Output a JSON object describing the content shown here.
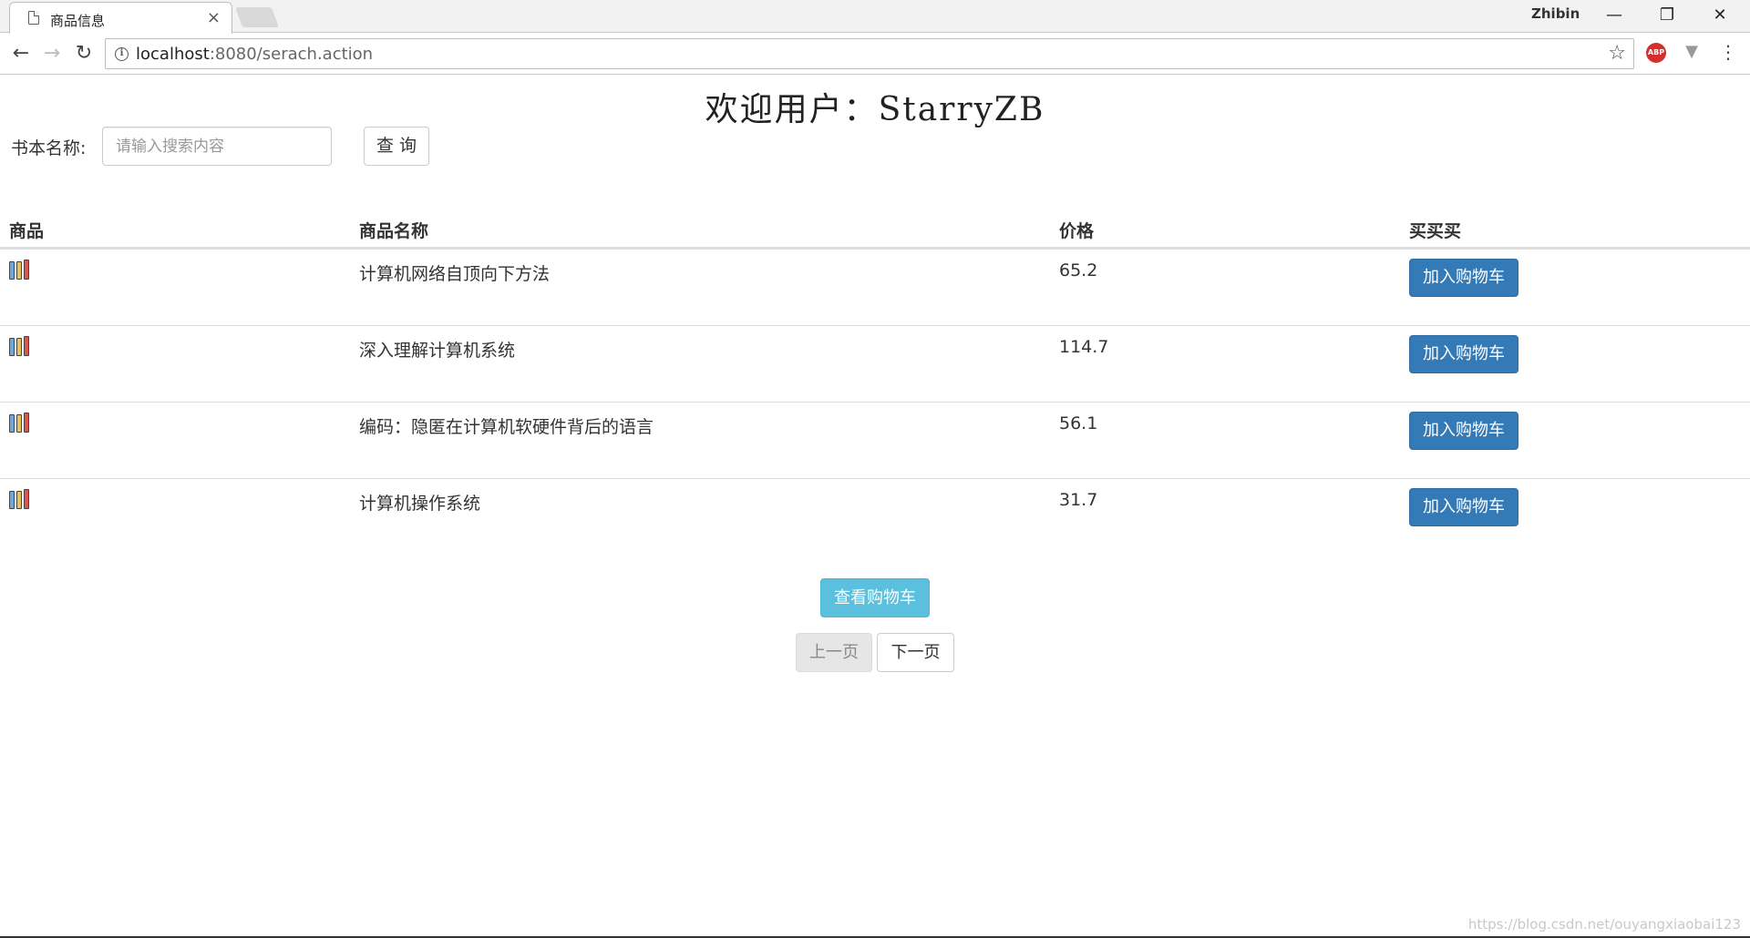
{
  "browser": {
    "tab_title": "商品信息",
    "tab_close": "×",
    "profile_name": "Zhibin",
    "url_host": "localhost",
    "url_rest": ":8080/serach.action",
    "window_buttons": {
      "minimize": "—",
      "restore": "❐",
      "close": "✕"
    },
    "ext_abp_label": "ABP"
  },
  "page": {
    "welcome": "欢迎用户：StarryZB",
    "search": {
      "label": "书本名称:",
      "placeholder": "请输入搜索内容",
      "button": "查 询"
    },
    "table": {
      "headers": [
        "商品",
        "商品名称",
        "价格",
        "买买买"
      ],
      "rows": [
        {
          "name": "计算机网络自顶向下方法",
          "price": "65.2",
          "action": "加入购物车"
        },
        {
          "name": "深入理解计算机系统",
          "price": "114.7",
          "action": "加入购物车"
        },
        {
          "name": "编码：隐匿在计算机软硬件背后的语言",
          "price": "56.1",
          "action": "加入购物车"
        },
        {
          "name": "计算机操作系统",
          "price": "31.7",
          "action": "加入购物车"
        }
      ]
    },
    "view_cart": "查看购物车",
    "pager": {
      "prev": "上一页",
      "next": "下一页"
    },
    "watermark": "https://blog.csdn.net/ouyangxiaobai123"
  },
  "colors": {
    "primary_button": "#337ab7",
    "info_button": "#5bc0de",
    "book_spines": [
      "#6fa8dc",
      "#e8c15b",
      "#d9534f"
    ]
  }
}
